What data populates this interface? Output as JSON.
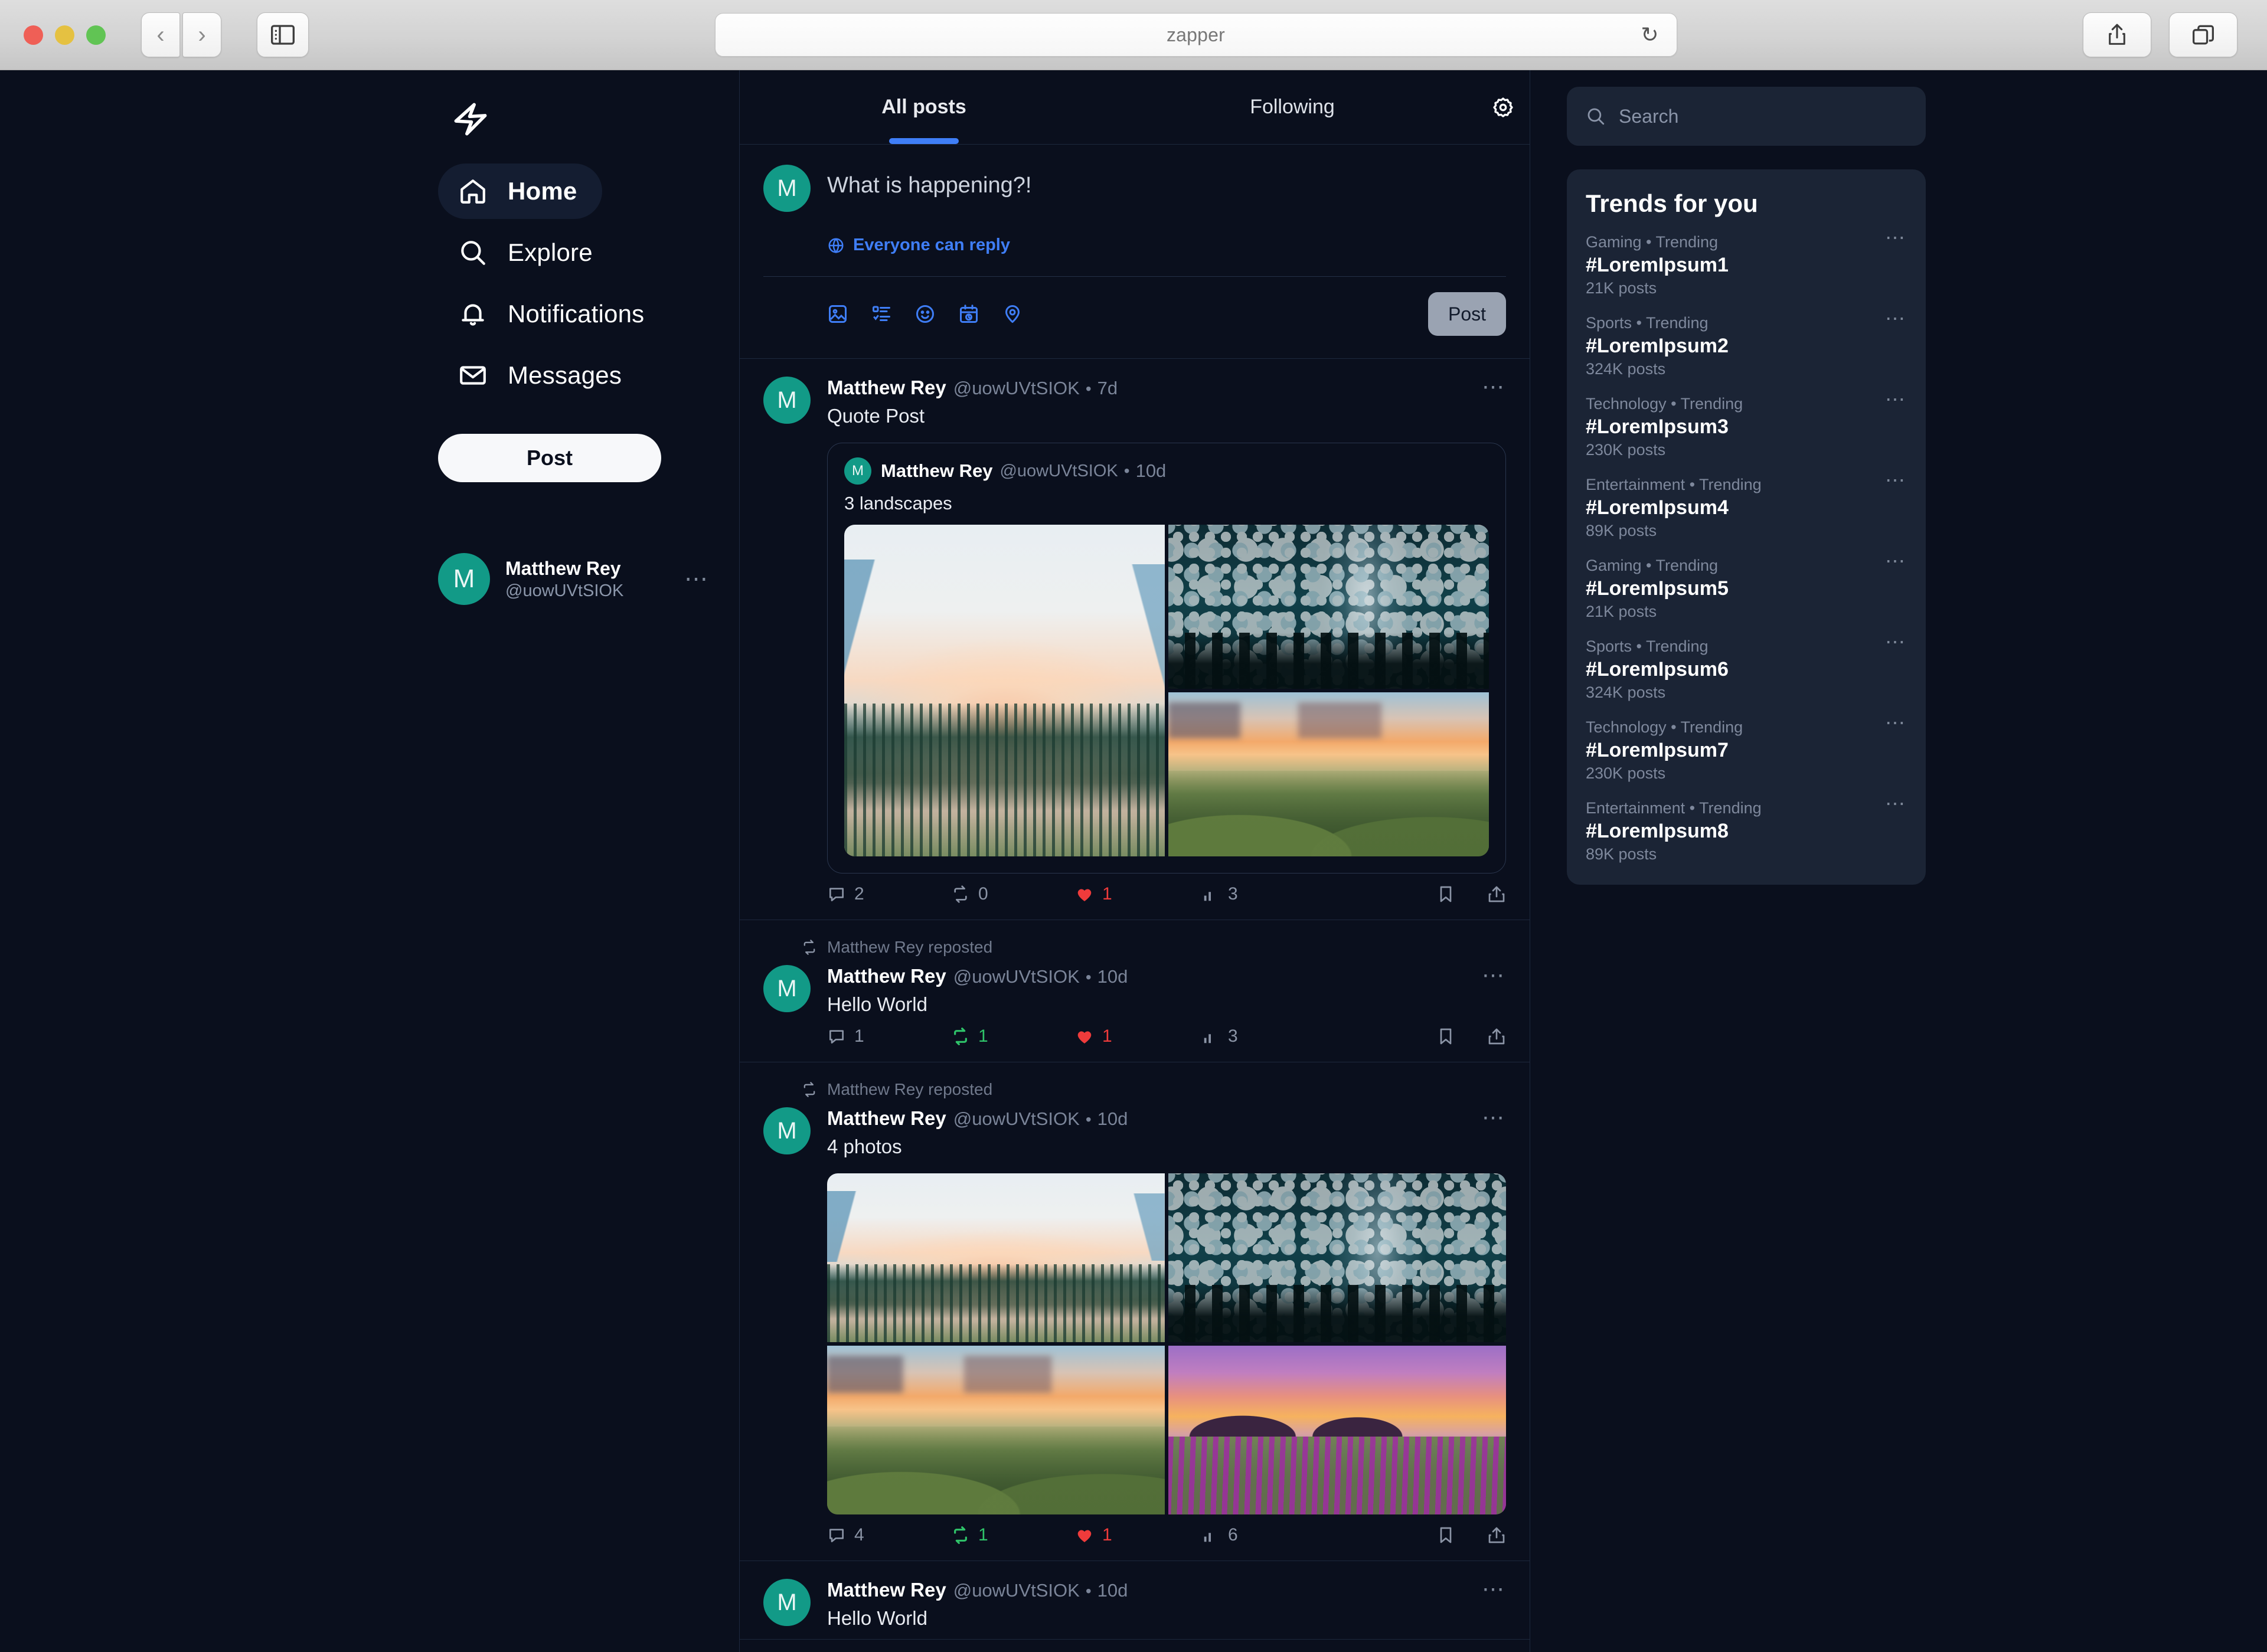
{
  "browser": {
    "address_value": "zapper",
    "back_icon": "chevron-left-icon",
    "forward_icon": "chevron-right-icon",
    "sidebar_icon": "sidebar-toggle-icon",
    "reload_icon": "reload-icon",
    "share_icon": "share-icon",
    "tabs_icon": "tab-overview-icon"
  },
  "colors": {
    "accent_blue": "#3f7ef7",
    "like_red": "#ef3b3b",
    "repost_green": "#2fc46a",
    "avatar_teal": "#129a87",
    "bg": "#0a0f1d",
    "panel": "#1b2435"
  },
  "sidebar": {
    "logo_icon": "lightning-bolt-logo",
    "items": [
      {
        "label": "Home",
        "icon": "home-icon",
        "active": true
      },
      {
        "label": "Explore",
        "icon": "search-icon",
        "active": false
      },
      {
        "label": "Notifications",
        "icon": "bell-icon",
        "active": false
      },
      {
        "label": "Messages",
        "icon": "envelope-icon",
        "active": false
      }
    ],
    "post_button": "Post",
    "profile": {
      "avatar_initial": "M",
      "name": "Matthew Rey",
      "handle": "@uowUVtSIOK",
      "more_icon": "ellipsis-icon"
    }
  },
  "feed": {
    "tabs": [
      {
        "label": "All posts",
        "active": true
      },
      {
        "label": "Following",
        "active": false
      }
    ],
    "settings_icon": "gear-icon",
    "composer": {
      "avatar_initial": "M",
      "placeholder": "What is happening?!",
      "reply_scope": "Everyone can reply",
      "reply_scope_icon": "globe-icon",
      "post_button": "Post",
      "icons": [
        "image-icon",
        "poll-list-icon",
        "emoji-icon",
        "schedule-icon",
        "location-icon"
      ]
    },
    "posts": [
      {
        "avatar_initial": "M",
        "name": "Matthew Rey",
        "handle": "@uowUVtSIOK",
        "time": "7d",
        "text": "Quote Post",
        "more_icon": "ellipsis-icon",
        "quote": {
          "avatar_initial": "M",
          "name": "Matthew Rey",
          "handle": "@uowUVtSIOK",
          "time": "10d",
          "text": "3 landscapes",
          "media": [
            "valley",
            "stars",
            "hills"
          ]
        },
        "stats": {
          "replies": "2",
          "reposts": "0",
          "likes": "1",
          "views": "3",
          "reposted": false,
          "liked": true
        }
      },
      {
        "repost_label": "Matthew Rey reposted",
        "repost_icon": "repost-icon",
        "avatar_initial": "M",
        "name": "Matthew Rey",
        "handle": "@uowUVtSIOK",
        "time": "10d",
        "text": "Hello World",
        "more_icon": "ellipsis-icon",
        "stats": {
          "replies": "1",
          "reposts": "1",
          "likes": "1",
          "views": "3",
          "reposted": true,
          "liked": true
        }
      },
      {
        "repost_label": "Matthew Rey reposted",
        "repost_icon": "repost-icon",
        "avatar_initial": "M",
        "name": "Matthew Rey",
        "handle": "@uowUVtSIOK",
        "time": "10d",
        "text": "4 photos",
        "more_icon": "ellipsis-icon",
        "media": [
          "valley",
          "stars",
          "hills",
          "lavender"
        ],
        "stats": {
          "replies": "4",
          "reposts": "1",
          "likes": "1",
          "views": "6",
          "reposted": true,
          "liked": true
        }
      },
      {
        "avatar_initial": "M",
        "name": "Matthew Rey",
        "handle": "@uowUVtSIOK",
        "time": "10d",
        "text": "Hello World",
        "more_icon": "ellipsis-icon"
      }
    ]
  },
  "right": {
    "search_placeholder": "Search",
    "search_icon": "search-icon",
    "trends_title": "Trends for you",
    "trends": [
      {
        "category": "Gaming • Trending",
        "tag": "#LoremIpsum1",
        "count": "21K posts"
      },
      {
        "category": "Sports • Trending",
        "tag": "#LoremIpsum2",
        "count": "324K posts"
      },
      {
        "category": "Technology • Trending",
        "tag": "#LoremIpsum3",
        "count": "230K posts"
      },
      {
        "category": "Entertainment • Trending",
        "tag": "#LoremIpsum4",
        "count": "89K posts"
      },
      {
        "category": "Gaming • Trending",
        "tag": "#LoremIpsum5",
        "count": "21K posts"
      },
      {
        "category": "Sports • Trending",
        "tag": "#LoremIpsum6",
        "count": "324K posts"
      },
      {
        "category": "Technology • Trending",
        "tag": "#LoremIpsum7",
        "count": "230K posts"
      },
      {
        "category": "Entertainment • Trending",
        "tag": "#LoremIpsum8",
        "count": "89K posts"
      }
    ]
  }
}
